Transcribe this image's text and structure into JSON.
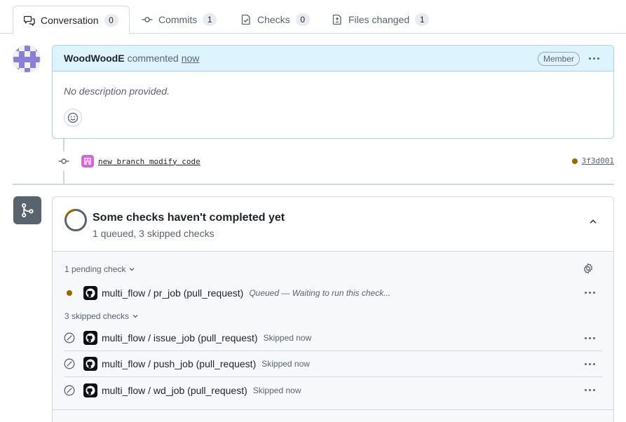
{
  "tabs": [
    {
      "label": "Conversation",
      "count": "0",
      "icon": "comment-discussion-icon"
    },
    {
      "label": "Commits",
      "count": "1",
      "icon": "git-commit-icon"
    },
    {
      "label": "Checks",
      "count": "0",
      "icon": "checklist-icon"
    },
    {
      "label": "Files changed",
      "count": "1",
      "icon": "file-diff-icon"
    }
  ],
  "comment": {
    "author": "WoodWoodE",
    "action": "commented",
    "time": "now",
    "role_badge": "Member",
    "body": "No description provided."
  },
  "commit": {
    "message": "new branch modify code",
    "sha": "3f3d001"
  },
  "checks": {
    "title": "Some checks haven't completed yet",
    "subtitle": "1 queued, 3 skipped checks",
    "pending_label": "1 pending check",
    "skipped_label": "3 skipped checks",
    "pending": [
      {
        "name": "multi_flow / pr_job (pull_request)",
        "status": "Queued — Waiting to run this check..."
      }
    ],
    "skipped": [
      {
        "name": "multi_flow / issue_job (pull_request)",
        "status": "Skipped now"
      },
      {
        "name": "multi_flow / push_job (pull_request)",
        "status": "Skipped now"
      },
      {
        "name": "multi_flow / wd_job (pull_request)",
        "status": "Skipped now"
      }
    ]
  },
  "colors": {
    "accent_blue_bg": "#ddf4ff",
    "accent_blue_border": "#a8d1f7",
    "pending": "#9a6700",
    "muted": "#59636e"
  }
}
